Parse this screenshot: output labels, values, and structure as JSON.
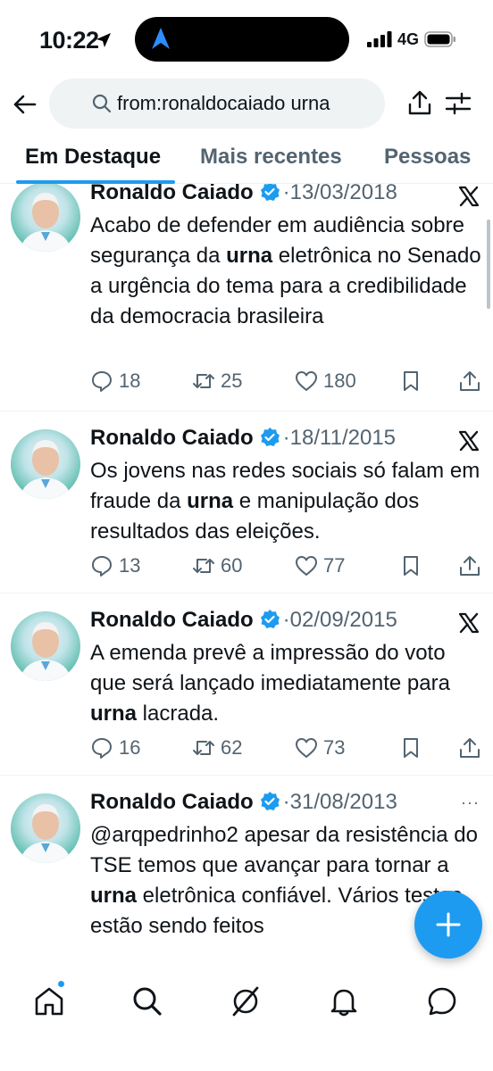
{
  "status_bar": {
    "time": "10:22",
    "network": "4G"
  },
  "search": {
    "query": "from:ronaldocaiado urna"
  },
  "tabs": [
    {
      "label": "Em Destaque",
      "active": true
    },
    {
      "label": "Mais recentes",
      "active": false
    },
    {
      "label": "Pessoas",
      "active": false
    }
  ],
  "tweets": [
    {
      "author": "Ronaldo Caiado",
      "date": "13/03/2018",
      "text_parts": [
        "Acabo de defender em audiência sobre segurança da ",
        "urna",
        " eletrônica no Senado a urgência do tema para a credibilidade da democracia brasileira"
      ],
      "replies": "18",
      "retweets": "25",
      "likes": "180",
      "source_icon": "x-logo-icon"
    },
    {
      "author": "Ronaldo Caiado",
      "date": "18/11/2015",
      "text_parts": [
        "Os jovens nas redes sociais só falam em fraude da ",
        "urna",
        " e manipulação dos resultados das eleições."
      ],
      "replies": "13",
      "retweets": "60",
      "likes": "77",
      "source_icon": "x-logo-icon"
    },
    {
      "author": "Ronaldo Caiado",
      "date": "02/09/2015",
      "text_parts": [
        "A emenda prevê a impressão do voto que será lançado imediatamente para ",
        "urna",
        " lacrada."
      ],
      "replies": "16",
      "retweets": "62",
      "likes": "73",
      "source_icon": "x-logo-icon"
    },
    {
      "author": "Ronaldo Caiado",
      "date": "31/08/2013",
      "text_parts": [
        "@arqpedrinho2  apesar da resistência do TSE temos que avançar para tornar a ",
        "urna",
        " eletrônica confiável. Vários testes estão sendo feitos"
      ],
      "more": "···"
    }
  ],
  "colors": {
    "accent": "#1d9bf0",
    "text_primary": "#0f1419",
    "text_secondary": "#536471"
  }
}
